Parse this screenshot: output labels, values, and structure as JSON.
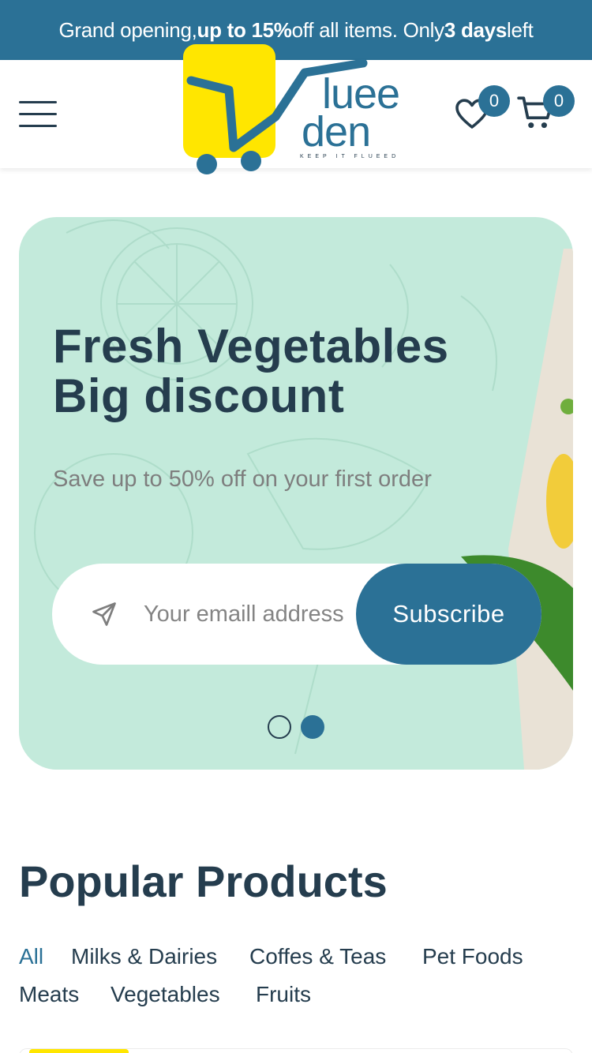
{
  "promo": {
    "part1": "Grand opening, ",
    "highlight": "up to 15%",
    "part2": " off all items. Only ",
    "days": "3 days",
    "part3": " left"
  },
  "header": {
    "logo": {
      "text_top": "luee",
      "text_bottom": "den",
      "tagline": "KEEP IT FLUEED",
      "brand_yellow": "#FFE600",
      "brand_blue": "#2B7196"
    },
    "wishlist_count": "0",
    "cart_count": "0"
  },
  "hero": {
    "title_line1": "Fresh Vegetables",
    "title_line2": "Big discount",
    "subtitle": "Save up to 50% off on your first order",
    "email_placeholder": "Your emaill address",
    "subscribe_label": "Subscribe",
    "slides_total": 2,
    "active_slide": 2
  },
  "popular": {
    "title": "Popular Products",
    "tabs": [
      "All",
      "Milks & Dairies",
      "Coffes & Teas",
      "Pet Foods",
      "Meats",
      "Vegetables",
      "Fruits"
    ],
    "active_tab": "All"
  },
  "colors": {
    "primary": "#2B7196",
    "heading": "#253D4E",
    "hero_bg": "#C3EADB",
    "muted_text": "#7E7E7E",
    "accent_yellow": "#FFE600"
  }
}
